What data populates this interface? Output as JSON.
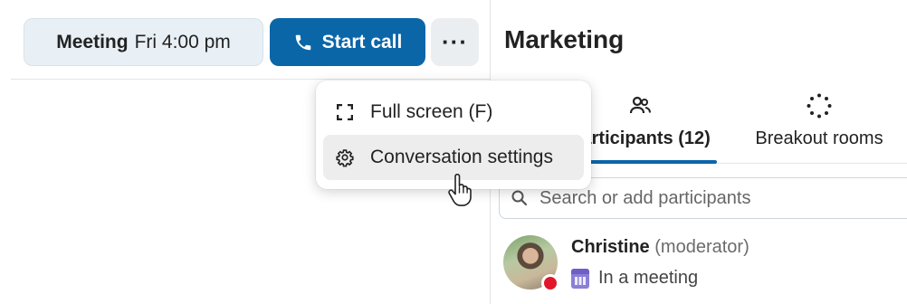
{
  "toolbar": {
    "meeting_label": "Meeting",
    "meeting_time": "Fri 4:00 pm",
    "start_call_label": "Start call",
    "more_label": "···"
  },
  "menu": {
    "items": [
      {
        "label": "Full screen (F)",
        "icon": "fullscreen-icon"
      },
      {
        "label": "Conversation settings",
        "icon": "gear-icon"
      }
    ]
  },
  "panel": {
    "title": "Marketing",
    "tabs": [
      {
        "label": "Participants (12)",
        "icon": "participants-icon",
        "active": true
      },
      {
        "label": "Breakout rooms",
        "icon": "breakout-rooms-icon",
        "active": false
      }
    ],
    "search": {
      "placeholder": "Search or add participants",
      "value": ""
    },
    "participants": [
      {
        "name": "Christine",
        "role": "(moderator)",
        "status": "In a meeting",
        "status_color": "#e3152b"
      }
    ]
  },
  "colors": {
    "accent": "#0b66a8",
    "busy": "#e3152b"
  }
}
